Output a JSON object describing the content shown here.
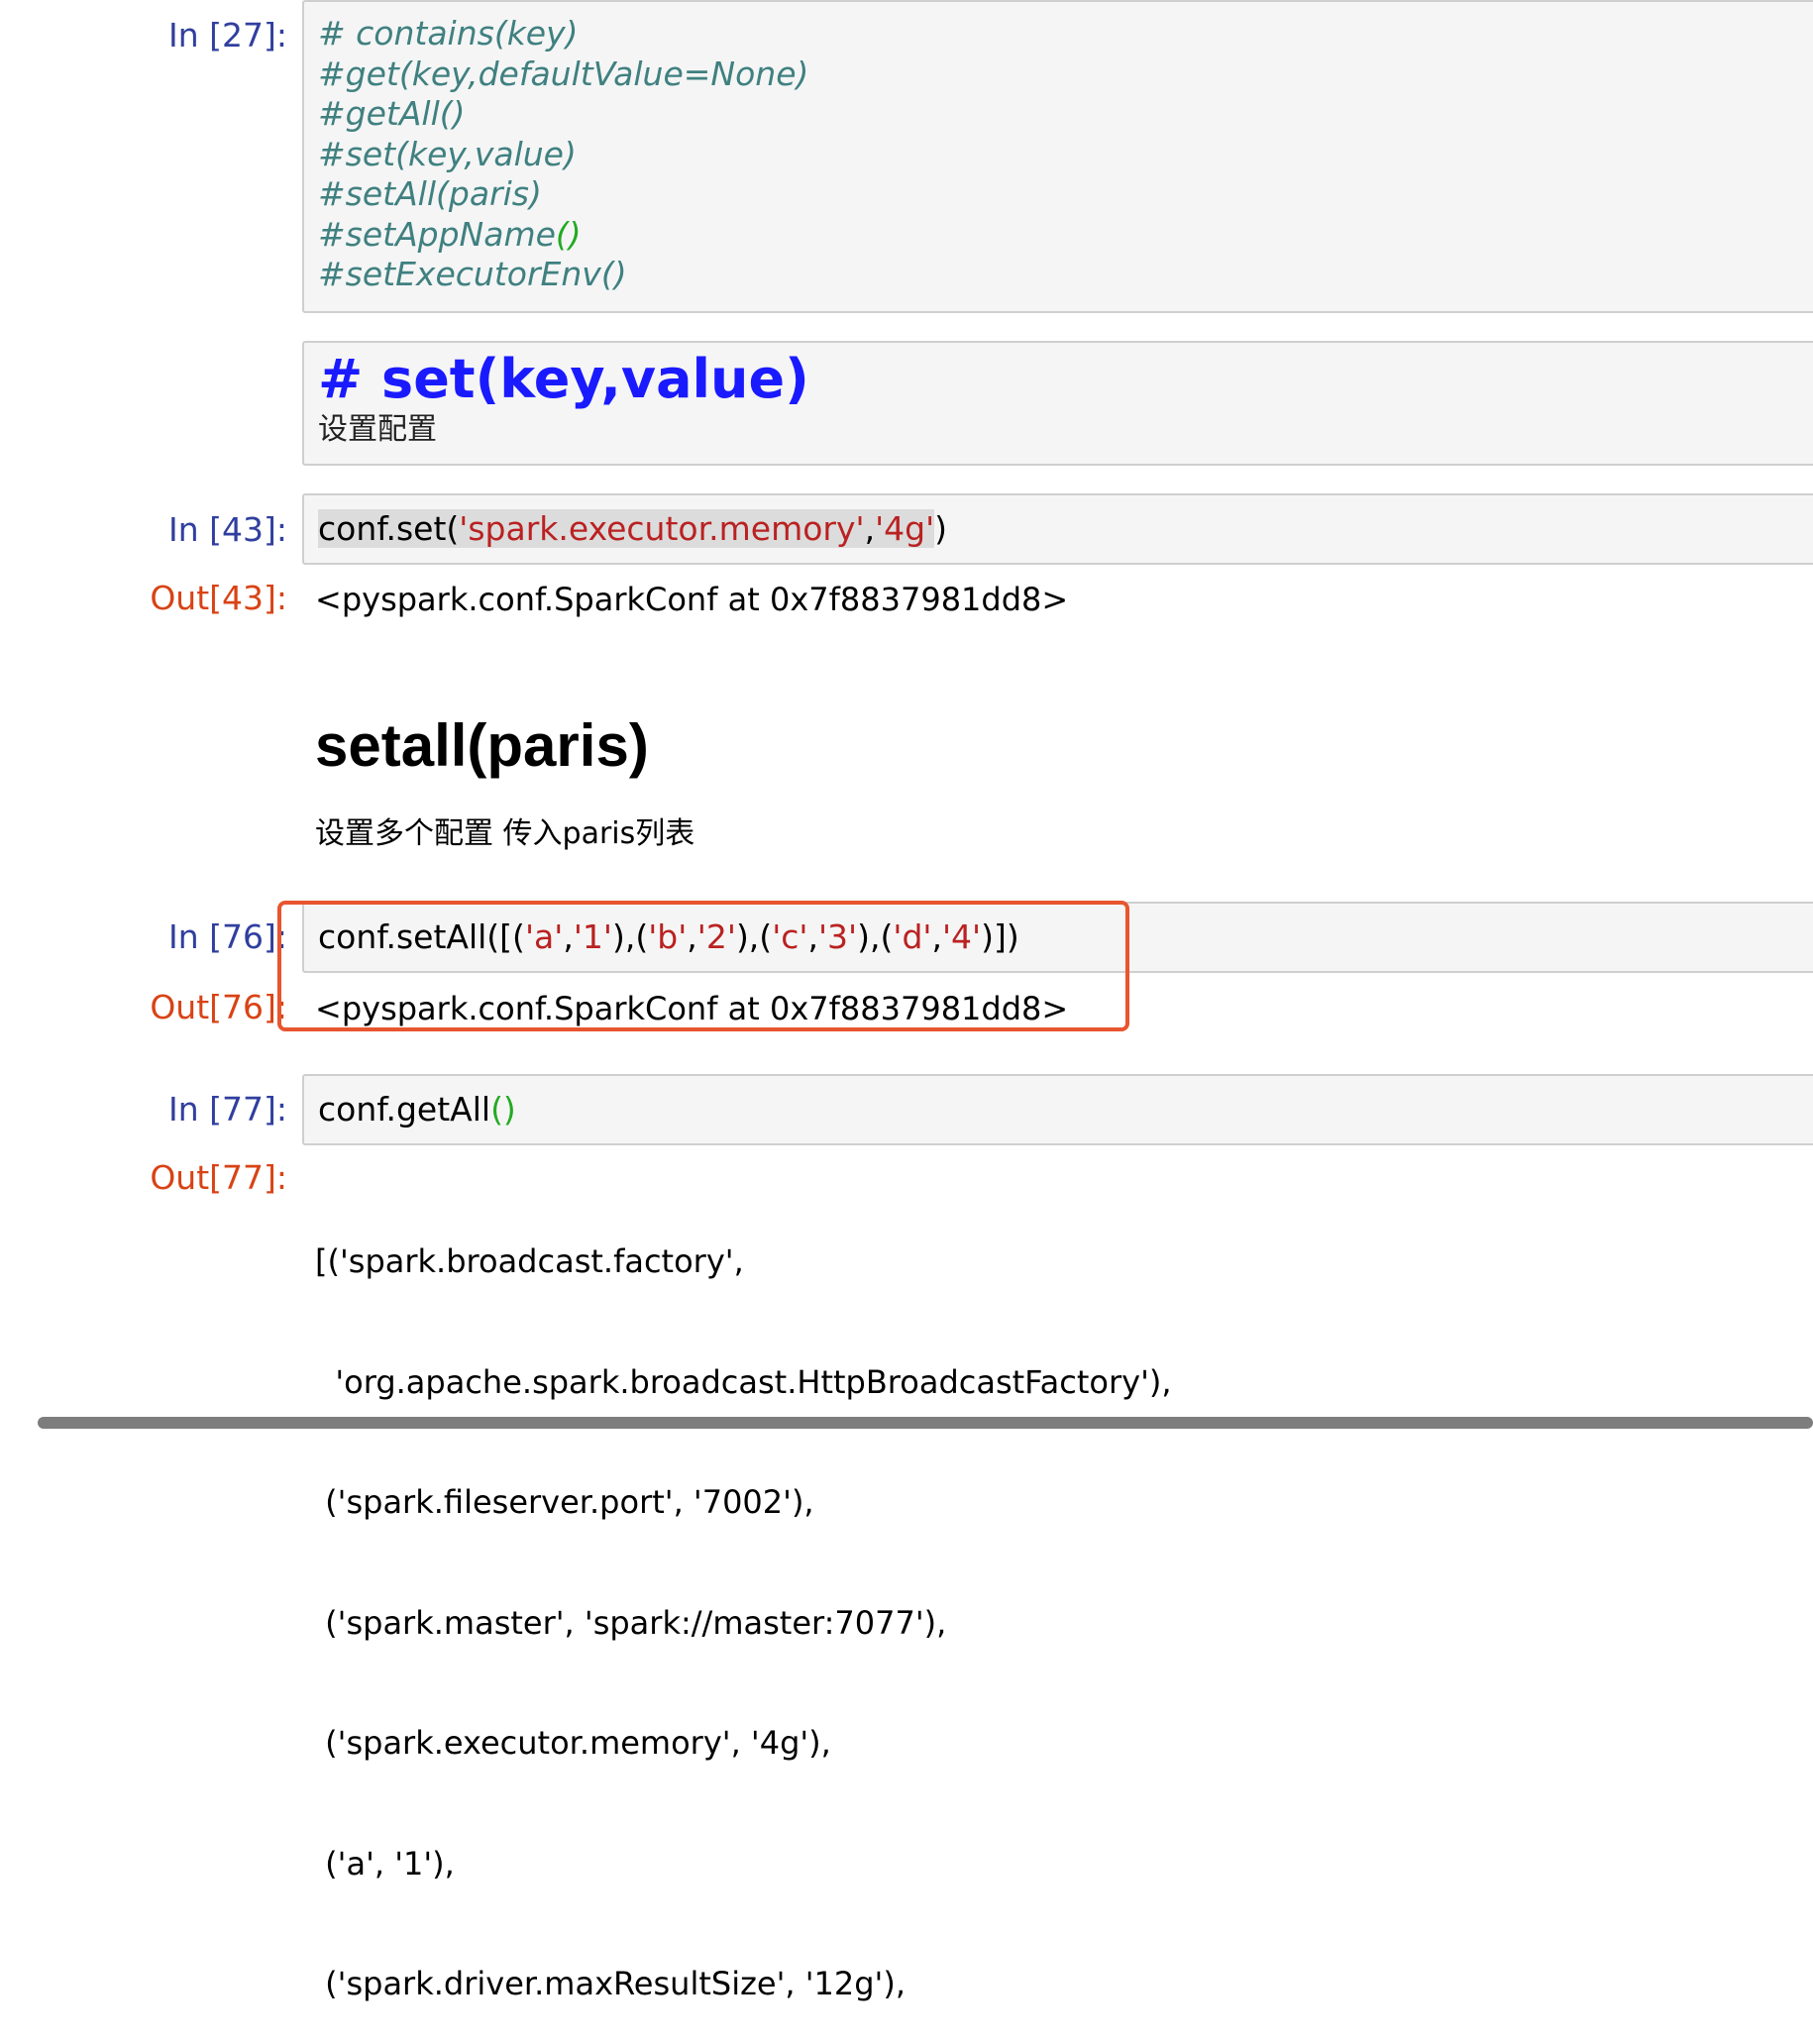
{
  "cells": {
    "c27": {
      "prompt": "In [27]:",
      "lines": [
        "# contains(key)",
        "#get(key,defaultValue=None)",
        "#getAll()",
        "#set(key,value)",
        "#setAll(paris)",
        "#setAppName",
        "()",
        "#setExecutorEnv()"
      ]
    },
    "md_set": {
      "heading": "# set(key,value)",
      "text": "设置配置"
    },
    "c43": {
      "prompt": "In [43]:",
      "code_prefix": "conf.set(",
      "str1": "'spark.executor.memory'",
      "comma": ",",
      "str2": "'4g'",
      "code_suffix": ")",
      "out_prompt": "Out[43]:",
      "output": "<pyspark.conf.SparkConf at 0x7f8837981dd8>"
    },
    "md_setall": {
      "heading": "setall(paris)",
      "text": "设置多个配置 传入paris列表"
    },
    "c76": {
      "prompt": "In [76]:",
      "tokens": [
        "conf.setAll([(",
        "'a'",
        ",",
        "'1'",
        "),(",
        "'b'",
        ",",
        "'2'",
        "),(",
        "'c'",
        ",",
        "'3'",
        "),(",
        "'d'",
        ",",
        "'4'",
        ")])"
      ],
      "out_prompt": "Out[76]:",
      "output": "<pyspark.conf.SparkConf at 0x7f8837981dd8>"
    },
    "c77": {
      "prompt": "In [77]:",
      "code_prefix": "conf.getAll",
      "code_paren": "()",
      "out_prompt": "Out[77]:",
      "output_lines": [
        "[('spark.broadcast.factory',",
        "  'org.apache.spark.broadcast.HttpBroadcastFactory'),",
        " ('spark.fileserver.port', '7002'),",
        " ('spark.master', 'spark://master:7077'),",
        " ('spark.executor.memory', '4g'),",
        " ('a', '1'),",
        " ('spark.driver.maxResultSize', '12g'),"
      ]
    }
  },
  "colors": {
    "in_prompt": "#303f9f",
    "out_prompt": "#d84315",
    "string": "#ba2121",
    "comment": "#408080",
    "paren": "#22aa22",
    "md_heading_raw": "#1a1aff",
    "highlight": "#e8552f"
  }
}
